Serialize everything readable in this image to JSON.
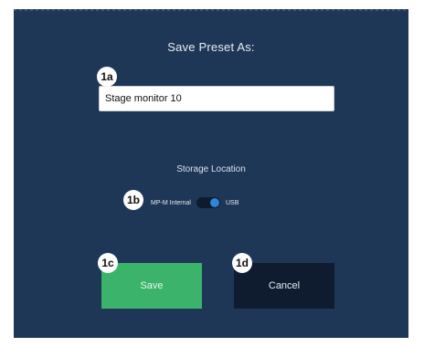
{
  "dialog": {
    "title": "Save Preset As:",
    "preset_name_value": "Stage monitor 10",
    "storage_label": "Storage Location",
    "storage_left_option": "MP-M Internal",
    "storage_right_option": "USB",
    "storage_selected": "USB",
    "save_label": "Save",
    "cancel_label": "Cancel"
  },
  "callouts": {
    "name": "1a",
    "storage": "1b",
    "save": "1c",
    "cancel": "1d"
  },
  "colors": {
    "panel": "#1f3756",
    "save": "#3bb36a",
    "cancel": "#0f1c30",
    "toggle_knob": "#2f86d8"
  }
}
